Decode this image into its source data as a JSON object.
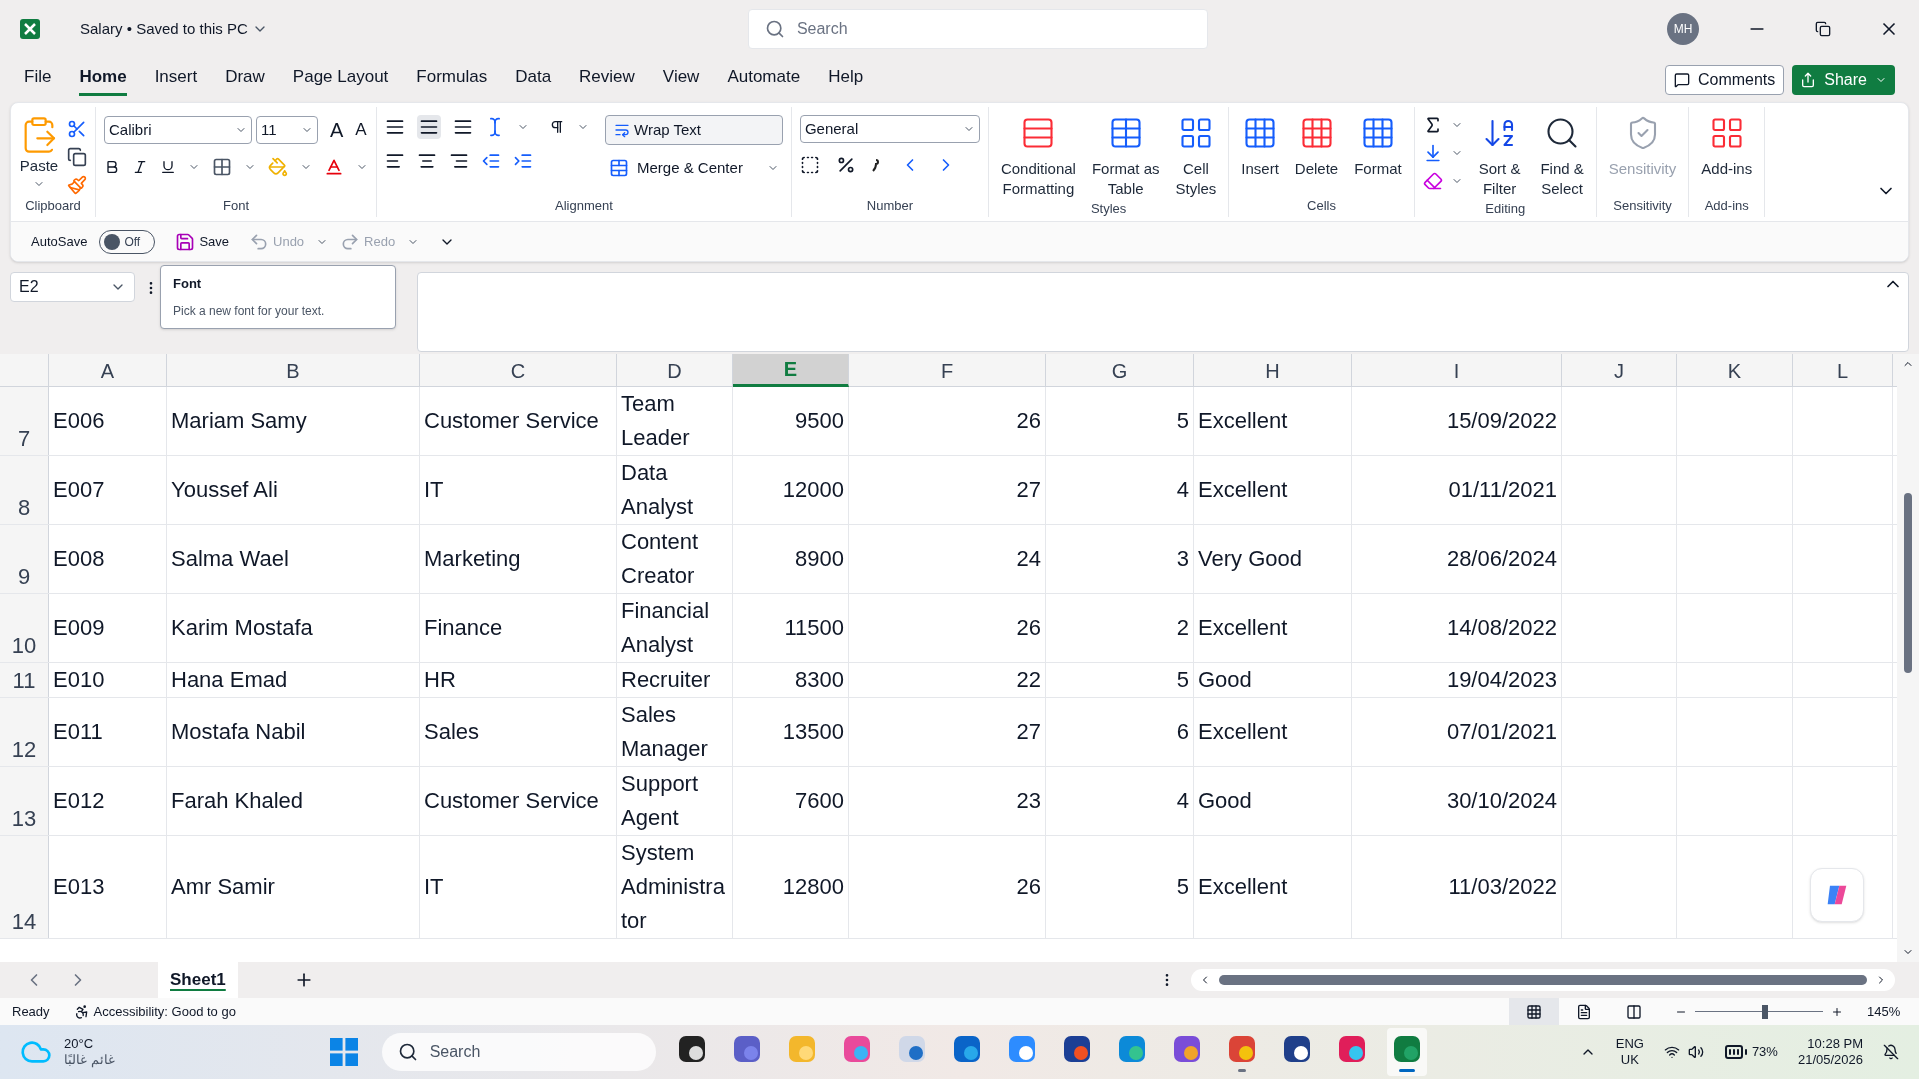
{
  "window": {
    "title": "Salary",
    "separator": "•",
    "save_status": "Saved to this PC",
    "search_placeholder": "Search",
    "user_initials": "MH"
  },
  "menu_tabs": [
    {
      "label": "File",
      "selected": false
    },
    {
      "label": "Home",
      "selected": true
    },
    {
      "label": "Insert",
      "selected": false
    },
    {
      "label": "Draw",
      "selected": false
    },
    {
      "label": "Page Layout",
      "selected": false
    },
    {
      "label": "Formulas",
      "selected": false
    },
    {
      "label": "Data",
      "selected": false
    },
    {
      "label": "Review",
      "selected": false
    },
    {
      "label": "View",
      "selected": false
    },
    {
      "label": "Automate",
      "selected": false
    },
    {
      "label": "Help",
      "selected": false
    }
  ],
  "comments_button": "Comments",
  "share_button": "Share",
  "ribbon": {
    "groups": [
      {
        "kind": "clipboard",
        "label": "Clipboard",
        "paste": "Paste"
      },
      {
        "kind": "font",
        "label": "Font",
        "font_name": "Calibri",
        "font_size": "11",
        "grow_font": "A",
        "shrink_font": "A"
      },
      {
        "kind": "alignment",
        "label": "Alignment",
        "wrap": "Wrap Text",
        "merge": "Merge & Center"
      },
      {
        "kind": "number",
        "label": "Number",
        "format": "General"
      },
      {
        "kind": "large",
        "label": "Styles",
        "buttons": [
          {
            "kind": "conditional",
            "label": "Conditional\nFormatting",
            "disabled": false
          },
          {
            "kind": "table",
            "label": "Format as\nTable",
            "disabled": false
          },
          {
            "kind": "styles",
            "label": "Cell\nStyles",
            "disabled": false
          }
        ]
      },
      {
        "kind": "large",
        "label": "Cells",
        "buttons": [
          {
            "kind": "insert",
            "label": "Insert",
            "disabled": false
          },
          {
            "kind": "delete",
            "label": "Delete",
            "disabled": false
          },
          {
            "kind": "format",
            "label": "Format",
            "disabled": false
          }
        ]
      },
      {
        "kind": "editing",
        "label": "Editing",
        "buttons": [
          {
            "kind": "sort",
            "label": "Sort &\nFilter",
            "disabled": false
          },
          {
            "kind": "find",
            "label": "Find &\nSelect",
            "disabled": false
          }
        ]
      },
      {
        "kind": "large",
        "label": "Sensitivity",
        "buttons": [
          {
            "kind": "sensitivity",
            "label": "Sensitivity",
            "disabled": true
          }
        ]
      },
      {
        "kind": "large",
        "label": "Add-ins",
        "buttons": [
          {
            "kind": "addins",
            "label": "Add-ins",
            "disabled": false
          }
        ]
      }
    ]
  },
  "quick_access": {
    "autosave_label": "AutoSave",
    "autosave": {
      "on": false,
      "text": "Off"
    },
    "save": "Save",
    "undo": {
      "label": "Undo",
      "disabled": true
    },
    "redo": {
      "label": "Redo",
      "disabled": true
    }
  },
  "name_box": "E2",
  "tooltip": {
    "title": "Font",
    "text": "Pick a new font for your text."
  },
  "sheet": {
    "columns": [
      {
        "label": "A",
        "selected": false,
        "kind": "text"
      },
      {
        "label": "B",
        "selected": false,
        "kind": "text"
      },
      {
        "label": "C",
        "selected": false,
        "kind": "text"
      },
      {
        "label": "D",
        "selected": false,
        "kind": "text"
      },
      {
        "label": "E",
        "selected": true,
        "kind": "number"
      },
      {
        "label": "F",
        "selected": false,
        "kind": "number"
      },
      {
        "label": "G",
        "selected": false,
        "kind": "number"
      },
      {
        "label": "H",
        "selected": false,
        "kind": "text"
      },
      {
        "label": "I",
        "selected": false,
        "kind": "number"
      },
      {
        "label": "J",
        "selected": false,
        "kind": "text"
      },
      {
        "label": "K",
        "selected": false,
        "kind": "text"
      },
      {
        "label": "L",
        "selected": false,
        "kind": "text"
      }
    ],
    "rows": [
      {
        "number": "7",
        "cells": [
          "E006",
          "Mariam Samy",
          "Customer Service",
          "Team Leader",
          "9500",
          "26",
          "5",
          "Excellent",
          "15/09/2022"
        ]
      },
      {
        "number": "8",
        "cells": [
          "E007",
          "Youssef Ali",
          "IT",
          "Data Analyst",
          "12000",
          "27",
          "4",
          "Excellent",
          "01/11/2021"
        ]
      },
      {
        "number": "9",
        "cells": [
          "E008",
          "Salma Wael",
          "Marketing",
          "Content Creator",
          "8900",
          "24",
          "3",
          "Very Good",
          "28/06/2024"
        ]
      },
      {
        "number": "10",
        "cells": [
          "E009",
          "Karim Mostafa",
          "Finance",
          "Financial Analyst",
          "11500",
          "26",
          "2",
          "Excellent",
          "14/08/2022"
        ]
      },
      {
        "number": "11",
        "cells": [
          "E010",
          "Hana Emad",
          "HR",
          "Recruiter",
          "8300",
          "22",
          "5",
          "Good",
          "19/04/2023"
        ]
      },
      {
        "number": "12",
        "cells": [
          "E011",
          "Mostafa Nabil",
          "Sales",
          "Sales Manager",
          "13500",
          "27",
          "6",
          "Excellent",
          "07/01/2021"
        ]
      },
      {
        "number": "13",
        "cells": [
          "E012",
          "Farah Khaled",
          "Customer Service",
          "Support Agent",
          "7600",
          "23",
          "4",
          "Good",
          "30/10/2024"
        ]
      },
      {
        "number": "14",
        "cells": [
          "E013",
          "Amr Samir",
          "IT",
          "System Administrator",
          "12800",
          "26",
          "5",
          "Excellent",
          "11/03/2022"
        ]
      }
    ]
  },
  "sheet_tabs": [
    {
      "label": "Sheet1",
      "selected": true
    }
  ],
  "status_bar": {
    "ready": "Ready",
    "accessibility": "Accessibility: Good to go",
    "views": [
      {
        "kind": "normal",
        "selected": true
      },
      {
        "kind": "layout",
        "selected": false
      },
      {
        "kind": "break",
        "selected": false
      }
    ],
    "zoom_slider": {
      "level": 0.55
    },
    "zoom": "145%"
  },
  "taskbar": {
    "temperature": "20°C",
    "weather": "غائم غالبًا",
    "search_placeholder": "Search",
    "apps": [
      {
        "kind": "taskview",
        "running": false,
        "active": false
      },
      {
        "kind": "teams",
        "running": false,
        "active": false
      },
      {
        "kind": "folder",
        "running": false,
        "active": false
      },
      {
        "kind": "copilot",
        "running": false,
        "active": false
      },
      {
        "kind": "window",
        "running": false,
        "active": false
      },
      {
        "kind": "outlook",
        "running": false,
        "active": false
      },
      {
        "kind": "zoom",
        "running": false,
        "active": false
      },
      {
        "kind": "store",
        "running": false,
        "active": false
      },
      {
        "kind": "edge",
        "running": false,
        "active": false
      },
      {
        "kind": "m365",
        "running": false,
        "active": false
      },
      {
        "kind": "chrome",
        "running": true,
        "active": false
      },
      {
        "kind": "cards",
        "running": false,
        "active": false
      },
      {
        "kind": "slack",
        "running": false,
        "active": false
      },
      {
        "kind": "excel",
        "running": true,
        "active": true
      }
    ],
    "language": "ENG",
    "region": "UK",
    "battery": "73%",
    "time": "10:28 PM",
    "date": "21/05/2026"
  }
}
